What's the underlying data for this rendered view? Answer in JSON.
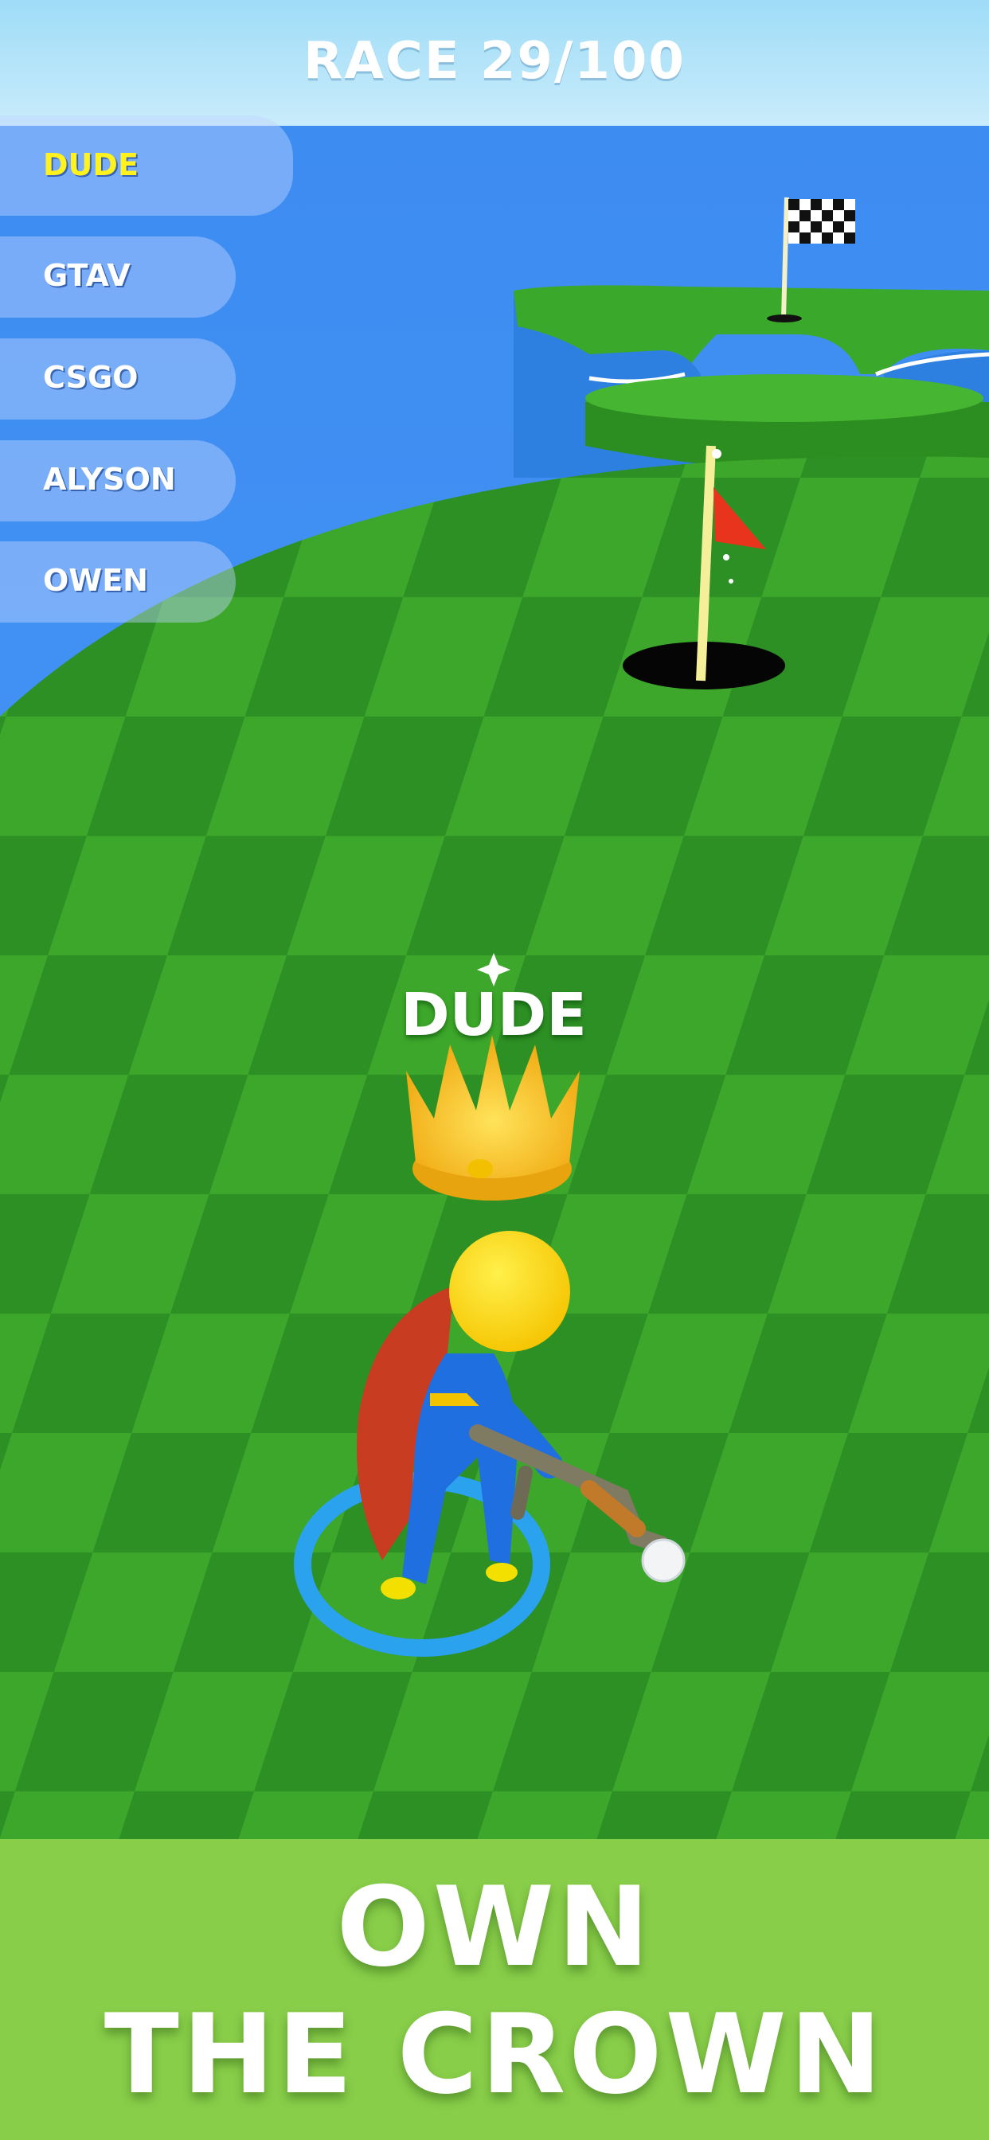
{
  "hud": {
    "race_label": "RACE 29/100"
  },
  "leaderboard": {
    "players": [
      "DUDE",
      "GTAV",
      "CSGO",
      "ALYSON",
      "OWEN"
    ],
    "current_player_index": 0
  },
  "player": {
    "name": "DUDE"
  },
  "banner": {
    "line1": "OWN",
    "line2": "THE CROWN"
  },
  "colors": {
    "grass_light": "#3fae2c",
    "grass_dark": "#2f9626",
    "water": "#3d8cf2",
    "sky": "#b8e6fa",
    "banner_green": "#89ce49",
    "highlight_yellow": "#fff21e",
    "crown_gold": "#f7c21a",
    "flag_red": "#e8341c"
  },
  "icons": [
    "crown-icon",
    "checkered-flag-icon",
    "red-flag-icon",
    "golf-hole-icon",
    "sparkle-icon"
  ]
}
